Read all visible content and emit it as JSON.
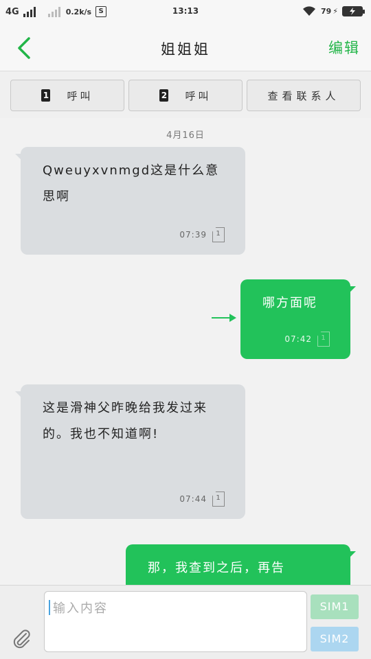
{
  "status_bar": {
    "network": "4G",
    "speed": "0.2k/s",
    "sim_icon": "S",
    "time": "13:13",
    "battery": "79"
  },
  "header": {
    "title": "姐姐姐",
    "edit_label": "编辑"
  },
  "actions": [
    {
      "sim": "1",
      "label": "呼叫"
    },
    {
      "sim": "2",
      "label": "呼叫"
    },
    {
      "label": "查看联系人"
    }
  ],
  "chat": {
    "date": "4月16日",
    "messages": [
      {
        "direction": "in",
        "text": "Qweuyxvnmgd这是什么意思啊",
        "time": "07:39",
        "sim": "1"
      },
      {
        "direction": "out",
        "text": "哪方面呢",
        "time": "07:42",
        "sim": "1"
      },
      {
        "direction": "in",
        "text": "这是滑神父昨晚给我发过来的。我也不知道啊!",
        "time": "07:44",
        "sim": "1"
      },
      {
        "direction": "out",
        "text": "那，我查到之后，再告",
        "time": "",
        "sim": ""
      }
    ]
  },
  "composer": {
    "placeholder": "输入内容",
    "sim1_label": "SIM1",
    "sim2_label": "SIM2"
  },
  "colors": {
    "accent_green": "#22b548",
    "bubble_out": "#22c25a",
    "bubble_in": "#dadde0",
    "sim1_button": "#a8e0bd",
    "sim2_button": "#acd6f0"
  }
}
